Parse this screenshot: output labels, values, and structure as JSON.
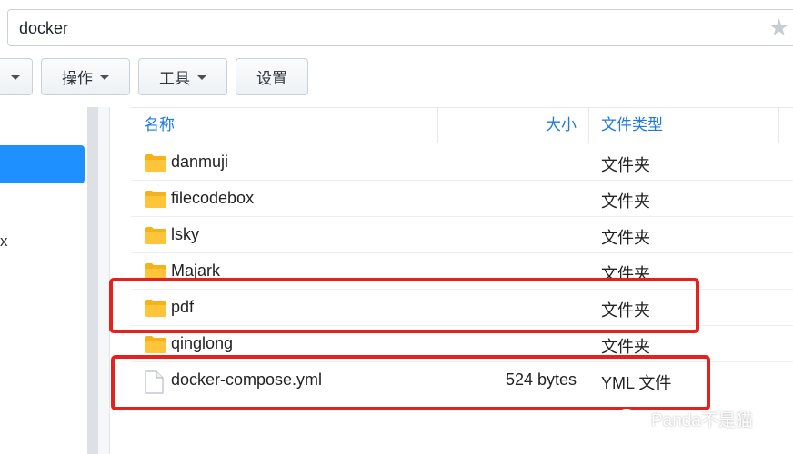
{
  "pathbar": {
    "path": "docker"
  },
  "toolbar": {
    "buttons": [
      {
        "label": ""
      },
      {
        "label": "操作"
      },
      {
        "label": "工具"
      },
      {
        "label": "设置"
      }
    ]
  },
  "sidebar": {
    "partial_item_text": "x"
  },
  "table": {
    "columns": {
      "name": "名称",
      "size": "大小",
      "type": "文件类型"
    },
    "rows": [
      {
        "name": "danmuji",
        "size": "",
        "type": "文件夹",
        "icon": "folder-icon"
      },
      {
        "name": "filecodebox",
        "size": "",
        "type": "文件夹",
        "icon": "folder-icon"
      },
      {
        "name": "lsky",
        "size": "",
        "type": "文件夹",
        "icon": "folder-icon"
      },
      {
        "name": "Majark",
        "size": "",
        "type": "文件夹",
        "icon": "folder-icon"
      },
      {
        "name": "pdf",
        "size": "",
        "type": "文件夹",
        "icon": "folder-icon"
      },
      {
        "name": "qinglong",
        "size": "",
        "type": "文件夹",
        "icon": "folder-icon"
      },
      {
        "name": "docker-compose.yml",
        "size": "524 bytes",
        "type": "YML 文件",
        "icon": "file-icon"
      }
    ]
  },
  "watermark": {
    "text": "Panda不是猫"
  },
  "colors": {
    "accent": "#1e90ff",
    "header_text": "#1f7ae0",
    "highlight": "#e6201c",
    "folder": "#f6b21a"
  }
}
